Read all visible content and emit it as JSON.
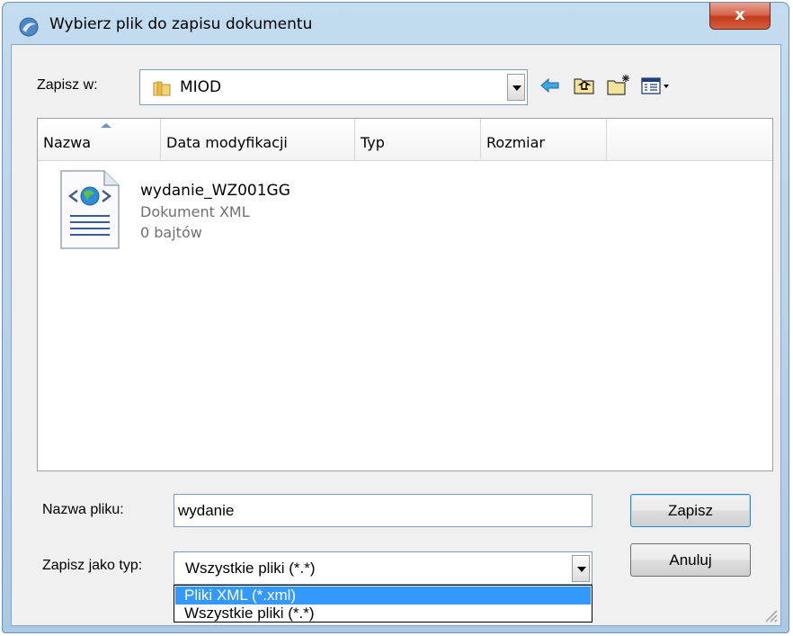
{
  "window": {
    "title": "Wybierz plik do zapisu dokumentu",
    "close_label": "x"
  },
  "toolbar": {
    "save_in_label": "Zapisz w:",
    "save_in_value": "MIOD",
    "icons": [
      "back-icon",
      "up-folder-icon",
      "new-folder-icon",
      "view-menu-icon"
    ]
  },
  "file_list": {
    "columns": [
      "Nazwa",
      "Data modyfikacji",
      "Typ",
      "Rozmiar"
    ],
    "sorted_column": "Nazwa",
    "items": [
      {
        "name": "wydanie_WZ001GG",
        "type": "Dokument XML",
        "size": "0 bajtów",
        "icon": "xml-file-icon"
      }
    ]
  },
  "form": {
    "filename_label": "Nazwa pliku:",
    "filename_value": "wydanie",
    "filetype_label": "Zapisz jako typ:",
    "filetype_value": "Wszystkie pliki (*.*)",
    "filetype_options": [
      "Pliki XML (*.xml)",
      "Wszystkie pliki (*.*)"
    ],
    "highlighted_option": "Pliki XML (*.xml)"
  },
  "buttons": {
    "save": "Zapisz",
    "cancel": "Anuluj"
  },
  "colors": {
    "selection": "#3399ff",
    "close_button": "#c43b1e",
    "frame": "#b5d1e9"
  }
}
